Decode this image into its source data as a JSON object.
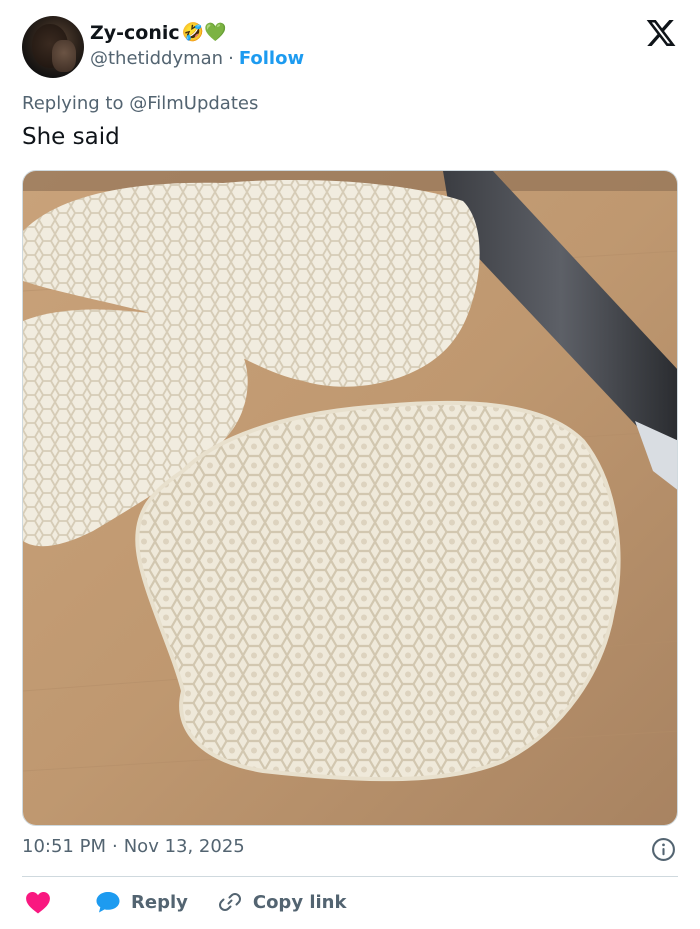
{
  "author": {
    "display_name": "Zy-conic",
    "emoji": "🤣💚",
    "handle": "@thetiddyman",
    "separator": "·",
    "follow_label": "Follow"
  },
  "reply": {
    "prefix": "Replying to ",
    "mention": "@FilmUpdates"
  },
  "tweet": {
    "text": "She said"
  },
  "media": {
    "description_icon": "photo"
  },
  "meta": {
    "time": "10:51 PM",
    "separator": "·",
    "date": "Nov 13, 2025"
  },
  "actions": {
    "reply_label": "Reply",
    "copy_label": "Copy link"
  },
  "colors": {
    "link": "#1d9bf0",
    "secondary": "#536471",
    "heart": "#f91880"
  }
}
